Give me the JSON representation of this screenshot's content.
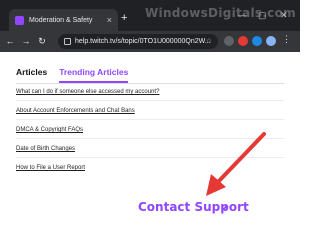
{
  "browser": {
    "tab_title": "Moderation & Safety",
    "tab_close": "×",
    "new_tab": "+",
    "url": "help.twitch.tv/s/topic/0TO1U000000Qn2W...",
    "minimize": "—",
    "maximize": "▢",
    "close": "✕"
  },
  "watermark": "WindowsDigitals.com",
  "page": {
    "tabs": [
      {
        "label": "Articles",
        "active": false
      },
      {
        "label": "Trending Articles",
        "active": true
      }
    ],
    "articles": [
      "What can I do if someone else accessed my account?",
      "About Account Enforcements and Chat Bans",
      "DMCA & Copyright FAQs",
      "Date of Birth Changes",
      "How to File a User Report"
    ],
    "contact_support": "Contact Support",
    "contact_icon": "⬈"
  },
  "colors": {
    "accent": "#9146ff",
    "arrow": "#e53935",
    "chrome_dark": "#202124",
    "chrome_toolbar": "#35363a"
  },
  "icons": [
    "back-arrow-icon",
    "forward-arrow-icon",
    "reload-icon",
    "lock-icon",
    "share-icon",
    "bookmark-star-icon",
    "external-link-icon"
  ]
}
